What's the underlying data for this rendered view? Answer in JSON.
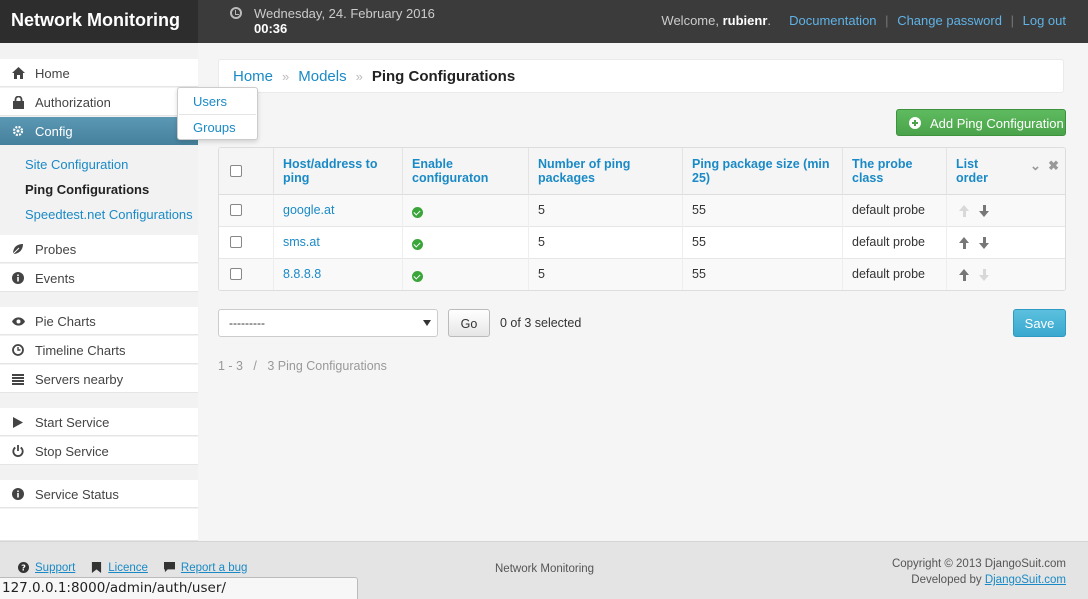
{
  "header": {
    "brand": "Network Monitoring",
    "date": "Wednesday, 24. February 2016",
    "time": "00:36",
    "welcome_prefix": "Welcome,",
    "username": "rubienr",
    "links": [
      "Documentation",
      "Change password",
      "Log out"
    ]
  },
  "sidebar": {
    "items": [
      {
        "label": "Home",
        "icon": "home-icon"
      },
      {
        "label": "Authorization",
        "icon": "lock-icon"
      },
      {
        "label": "Config",
        "icon": "gear-icon"
      },
      {
        "label": "Probes",
        "icon": "leaf-icon"
      },
      {
        "label": "Events",
        "icon": "info-icon"
      },
      {
        "label": "Pie Charts",
        "icon": "eye-icon"
      },
      {
        "label": "Timeline Charts",
        "icon": "clock-icon"
      },
      {
        "label": "Servers nearby",
        "icon": "list-icon"
      },
      {
        "label": "Start Service",
        "icon": "play-icon"
      },
      {
        "label": "Stop Service",
        "icon": "power-icon"
      },
      {
        "label": "Service Status",
        "icon": "info-icon"
      }
    ],
    "subitems": [
      "Site Configuration",
      "Ping Configurations",
      "Speedtest.net Configurations"
    ],
    "popover": [
      "Users",
      "Groups"
    ]
  },
  "breadcrumb": {
    "home": "Home",
    "models": "Models",
    "current": "Ping Configurations"
  },
  "add_button": "Add Ping Configuration",
  "table": {
    "columns": [
      "Host/address to ping",
      "Enable configuraton",
      "Number of ping packages",
      "Ping package size (min 25)",
      "The probe class",
      "List order"
    ],
    "rows": [
      {
        "host": "google.at",
        "enabled": true,
        "packages": "5",
        "size": "55",
        "probe": "default probe",
        "up": false,
        "down": true
      },
      {
        "host": "sms.at",
        "enabled": true,
        "packages": "5",
        "size": "55",
        "probe": "default probe",
        "up": true,
        "down": true
      },
      {
        "host": "8.8.8.8",
        "enabled": true,
        "packages": "5",
        "size": "55",
        "probe": "default probe",
        "up": true,
        "down": false
      }
    ]
  },
  "actions": {
    "select_value": "---------",
    "go": "Go",
    "selected": "0 of 3 selected",
    "save": "Save"
  },
  "pager": "1 - 3   /   3 Ping Configurations",
  "footer": {
    "support": "Support",
    "licence": "Licence",
    "bug": "Report a bug",
    "center": "Network Monitoring",
    "copyright": "Copyright © 2013 DjangoSuit.com",
    "developed_prefix": "Developed by",
    "developed_link": "DjangoSuit.com"
  },
  "statusbar": "127.0.0.1:8000/admin/auth/user/",
  "colors": {
    "accent": "#1a8ac6",
    "success": "#4aa34a",
    "save": "#3aa8cf",
    "header": "#3b3b3b"
  }
}
